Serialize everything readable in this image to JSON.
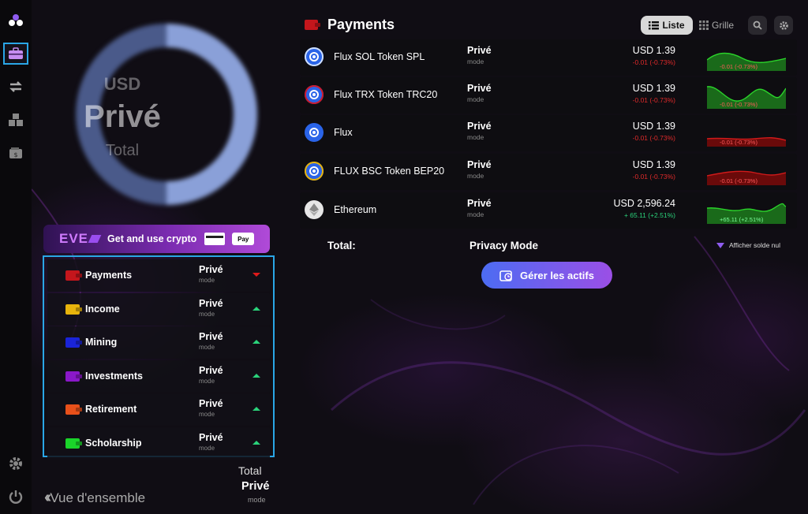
{
  "sidebar": {
    "icons": [
      "app-logo-icon",
      "briefcase-icon",
      "transfer-icon",
      "blocks-icon",
      "wallet-icon",
      "settings-icon",
      "power-icon"
    ]
  },
  "overview": {
    "donut_currency": "USD",
    "donut_value": "Privé",
    "donut_label": "Total"
  },
  "eve_banner": {
    "logo": "EVE",
    "text": "Get and use crypto",
    "apple_pay": "Pay"
  },
  "categories": [
    {
      "name": "Payments",
      "value": "Privé",
      "mode": "mode",
      "color": "#c4161c",
      "trend": "down"
    },
    {
      "name": "Income",
      "value": "Privé",
      "mode": "mode",
      "color": "#e8b40c",
      "trend": "up"
    },
    {
      "name": "Mining",
      "value": "Privé",
      "mode": "mode",
      "color": "#1a24d8",
      "trend": "up"
    },
    {
      "name": "Investments",
      "value": "Privé",
      "mode": "mode",
      "color": "#8a18c8",
      "trend": "up"
    },
    {
      "name": "Retirement",
      "value": "Privé",
      "mode": "mode",
      "color": "#e8501a",
      "trend": "up"
    },
    {
      "name": "Scholarship",
      "value": "Privé",
      "mode": "mode",
      "color": "#1ad42a",
      "trend": "up"
    }
  ],
  "left_footer": {
    "total_label": "Total",
    "total_value": "Privé",
    "mode": "mode",
    "back_label": "Vue d'ensemble"
  },
  "header": {
    "title": "Payments",
    "view_list": "Liste",
    "view_grid": "Grille"
  },
  "assets": [
    {
      "name": "Flux SOL Token SPL",
      "value_label": "Privé",
      "mode": "mode",
      "price": "USD 1.39",
      "change": "-0.01 (-0.73%)",
      "trend": "down",
      "spark_label": "-0.01 (-0.73%)",
      "coin_color": "#2a64e8"
    },
    {
      "name": "Flux TRX Token TRC20",
      "value_label": "Privé",
      "mode": "mode",
      "price": "USD 1.39",
      "change": "-0.01 (-0.73%)",
      "trend": "down",
      "spark_label": "-0.01 (-0.73%)",
      "coin_color": "#2a64e8"
    },
    {
      "name": "Flux",
      "value_label": "Privé",
      "mode": "mode",
      "price": "USD 1.39",
      "change": "-0.01 (-0.73%)",
      "trend": "down",
      "spark_label": "-0.01 (-0.73%)",
      "coin_color": "#2a64e8"
    },
    {
      "name": "FLUX BSC Token BEP20",
      "value_label": "Privé",
      "mode": "mode",
      "price": "USD 1.39",
      "change": "-0.01 (-0.73%)",
      "trend": "down",
      "spark_label": "-0.01 (-0.73%)",
      "coin_color": "#2a64e8"
    },
    {
      "name": "Ethereum",
      "value_label": "Privé",
      "mode": "mode",
      "price": "USD 2,596.24",
      "change": "+ 65.11 (+2.51%)",
      "trend": "up",
      "spark_label": "+65.11 (+2.51%)",
      "coin_color": "#e6e6e6"
    }
  ],
  "footer": {
    "total_label": "Total:",
    "privacy_label": "Privacy Mode",
    "show_zero_label": "Afficher solde nul",
    "manage_button": "Gérer les actifs"
  },
  "colors": {
    "accent_blue": "#2aa6e6",
    "up": "#2ad27a",
    "down": "#e01a1a"
  }
}
